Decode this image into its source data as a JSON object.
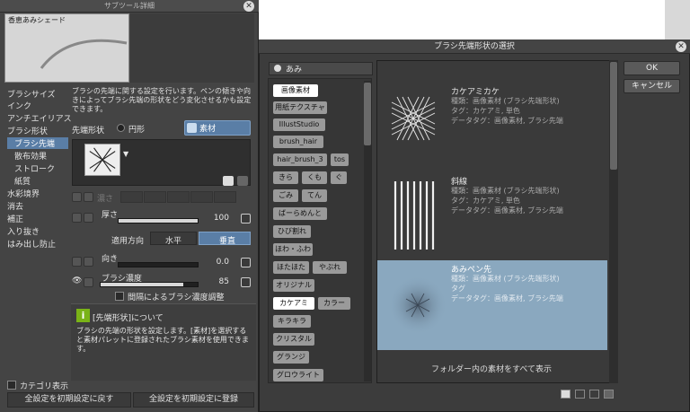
{
  "left_panel": {
    "title": "サブツール詳細",
    "preview_label": "香恵あみシェード",
    "categories": [
      {
        "label": "ブラシサイズ",
        "sub": false
      },
      {
        "label": "インク",
        "sub": false
      },
      {
        "label": "アンチエイリアス",
        "sub": false
      },
      {
        "label": "ブラシ形状",
        "sub": false
      },
      {
        "label": "ブラシ先端",
        "sub": true,
        "selected": true
      },
      {
        "label": "散布効果",
        "sub": true
      },
      {
        "label": "ストローク",
        "sub": true
      },
      {
        "label": "紙質",
        "sub": true
      },
      {
        "label": "水彩境界",
        "sub": false
      },
      {
        "label": "消去",
        "sub": false
      },
      {
        "label": "補正",
        "sub": false
      },
      {
        "label": "入り抜き",
        "sub": false
      },
      {
        "label": "はみ出し防止",
        "sub": false
      }
    ],
    "description": "ブラシの先端に関する設定を行います。ペンの傾きや向きによってブラシ先端の形状をどう変化させるかも設定できます。",
    "tip_shape_label": "先端形状",
    "circle_label": "円形",
    "material_label": "素材",
    "disabled_label": "濃さ",
    "thickness_label": "厚さ",
    "thickness_value": "100",
    "thickness_fill": 1.0,
    "apply_direction_label": "適用方向",
    "horizontal_label": "水平",
    "vertical_label": "垂直",
    "direction_label": "向き",
    "direction_value": "0.0",
    "brush_density_label": "ブラシ濃度",
    "brush_density_value": "85",
    "brush_density_fill": 0.85,
    "interval_density_label": "間隔によるブラシ濃度調整",
    "info_title": "[先端形状]について",
    "info_text": "ブラシの先端の形状を設定します。[素材]を選択すると素材パレットに登録されたブラシ素材を使用できます。",
    "category_display_label": "カテゴリ表示",
    "reset_button": "全設定を初期設定に戻す",
    "register_button": "全設定を初期設定に登録"
  },
  "dialog": {
    "title": "ブラシ先端形状の選択",
    "search_tag": "あみ",
    "tags": [
      {
        "label": "画像素材",
        "on": true
      },
      {
        "label": "用紙テクスチャ"
      },
      {
        "label": "IllustStudio"
      },
      {
        "label": "brush_hair"
      },
      {
        "label": "hair_brush_3"
      },
      {
        "label": "tos"
      },
      {
        "label": "きら"
      },
      {
        "label": "くも"
      },
      {
        "label": "ぐ"
      },
      {
        "label": "ごみ"
      },
      {
        "label": "てん"
      },
      {
        "label": "ばーらめんと"
      },
      {
        "label": "ひび割れ"
      },
      {
        "label": "ほわ・ふわ"
      },
      {
        "label": "ほたほた"
      },
      {
        "label": "やぶれ"
      },
      {
        "label": "オリジナル"
      },
      {
        "label": "カケアミ",
        "on": true
      },
      {
        "label": "カラー"
      },
      {
        "label": "キラキラ"
      },
      {
        "label": "クリスタル"
      },
      {
        "label": "グランジ"
      },
      {
        "label": "グロウライト"
      }
    ],
    "items": [
      {
        "name": "カケアミカケ",
        "line1": "種類：画像素材 (ブラシ先端形状)",
        "line2": "タグ：カケアミ, 単色",
        "line3": "データタグ：画像素材, ブラシ先端"
      },
      {
        "name": "斜線",
        "line1": "種類：画像素材 (ブラシ先端形状)",
        "line2": "タグ：カケアミ, 単色",
        "line3": "データタグ：画像素材, ブラシ先端"
      },
      {
        "name": "あみペン先",
        "line1": "種類：画像素材 (ブラシ先端形状)",
        "line2": "タグ",
        "line3": "データタグ：画像素材, ブラシ先端"
      }
    ],
    "show_all_label": "フォルダー内の素材をすべて表示",
    "ok_label": "OK",
    "cancel_label": "キャンセル"
  },
  "colors": {
    "accent": "#5a7ea6",
    "selected_item": "#8aa8bf",
    "info_icon": "#7ab317"
  }
}
